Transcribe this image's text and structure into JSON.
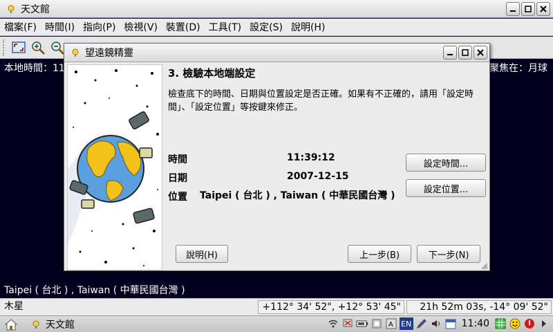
{
  "window": {
    "title": "天文館"
  },
  "menu": [
    "檔案(F)",
    "時間(I)",
    "指向(P)",
    "檢視(V)",
    "裝置(D)",
    "工具(T)",
    "設定(S)",
    "說明(H)"
  ],
  "sky": {
    "local_time_label": "本地時間：11",
    "focus_label": "聚焦在：月球",
    "location_text": "Taipei ( 台北 ) , Taiwan ( 中華民國台灣 )"
  },
  "dialog": {
    "title": "望遠鏡精靈",
    "step_title": "3. 檢驗本地端設定",
    "description": "檢查底下的時間、日期與位置設定是否正確。如果有不正確的，請用「設定時間」、「設定位置」等按鍵來修正。",
    "time_label": "時間",
    "time_value": "11:39:12",
    "date_label": "日期",
    "date_value": "2007-12-15",
    "location_label": "位置",
    "location_value": "Taipei ( 台北 ) , Taiwan ( 中華民國台灣 )",
    "set_time_button": "設定時間...",
    "set_location_button": "設定位置...",
    "help_button": "說明(H)",
    "back_button": "上一步(B)",
    "next_button": "下一步(N)"
  },
  "statusbar": {
    "object": "木星",
    "altaz": "+112° 34' 52\",  +12° 53' 45\"",
    "radec": "21h 52m 03s,  -14° 09' 52\""
  },
  "taskbar": {
    "app_label": "天文館",
    "clock": "11:40",
    "lang_indicator": "EN"
  },
  "colors": {
    "sky_bg": "#00001e",
    "dialog_bg": "#ececec"
  }
}
